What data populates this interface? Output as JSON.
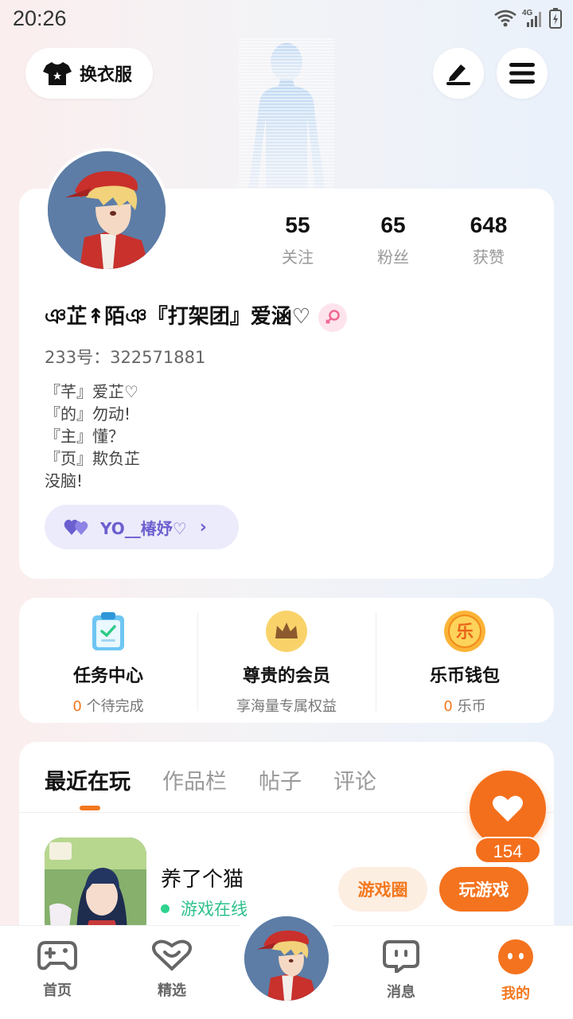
{
  "status_bar": {
    "time": "20:26",
    "network": "4G"
  },
  "header": {
    "outfit_label": "换衣服"
  },
  "profile": {
    "stats": [
      {
        "value": "55",
        "label": "关注"
      },
      {
        "value": "65",
        "label": "粉丝"
      },
      {
        "value": "648",
        "label": "获赞"
      }
    ],
    "nickname": "ঞ芷↟陌ঞ『打架团』爱涵♡",
    "uid": "233号：322571881",
    "bio": [
      "『芊』爱芷♡",
      "『的』勿动!",
      "『主』懂？",
      "『页』欺负芷",
      "没脑!"
    ],
    "cp_name": "YO__椿妤♡"
  },
  "services": [
    {
      "title": "任务中心",
      "count": "0",
      "suffix": " 个待完成"
    },
    {
      "title": "尊贵的会员",
      "subtitle": "享海量专属权益"
    },
    {
      "title": "乐币钱包",
      "count": "0",
      "suffix": " 乐币"
    }
  ],
  "tabs": [
    "最近在玩",
    "作品栏",
    "帖子",
    "评论"
  ],
  "recent_game": {
    "name": "养了个猫",
    "status": "游戏在线",
    "circle_button": "游戏圈",
    "play_button": "玩游戏"
  },
  "like_fab": {
    "count": "154"
  },
  "nav": [
    {
      "label": "首页"
    },
    {
      "label": "精选"
    },
    {
      "label": "消息"
    },
    {
      "label": "我的"
    }
  ],
  "colors": {
    "accent": "#f3781f",
    "online": "#2fc18c",
    "cp": "#6c5fcf"
  }
}
